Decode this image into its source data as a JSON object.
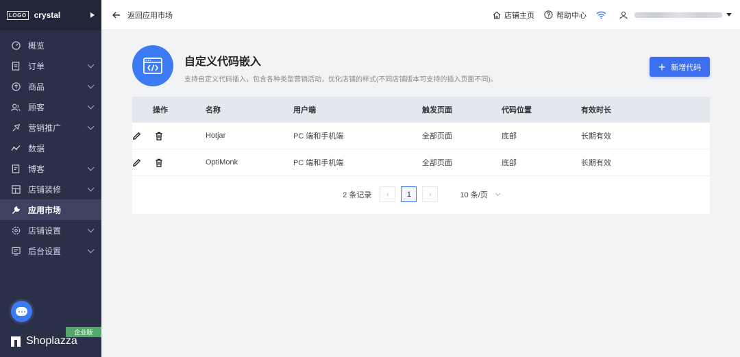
{
  "sidebar": {
    "logo": "LOGO",
    "store_name": "crystal",
    "items": [
      {
        "label": "概览",
        "icon": "dashboard-icon",
        "has_children": false
      },
      {
        "label": "订单",
        "icon": "order-icon",
        "has_children": true
      },
      {
        "label": "商品",
        "icon": "product-icon",
        "has_children": true
      },
      {
        "label": "顾客",
        "icon": "customers-icon",
        "has_children": true
      },
      {
        "label": "营销推广",
        "icon": "marketing-icon",
        "has_children": true
      },
      {
        "label": "数据",
        "icon": "analytics-icon",
        "has_children": false
      },
      {
        "label": "博客",
        "icon": "blog-icon",
        "has_children": true
      },
      {
        "label": "店铺装修",
        "icon": "theme-icon",
        "has_children": true
      },
      {
        "label": "应用市场",
        "icon": "wrench-icon",
        "has_children": false,
        "active": true
      },
      {
        "label": "店铺设置",
        "icon": "gear-icon",
        "has_children": true
      },
      {
        "label": "后台设置",
        "icon": "monitor-icon",
        "has_children": true
      }
    ],
    "edition_badge": "企业版",
    "footer_brand": "Shoplazza"
  },
  "topbar": {
    "back_label": "返回应用市场",
    "store_home": "店铺主页",
    "help_center": "帮助中心"
  },
  "page": {
    "title": "自定义代码嵌入",
    "description": "支持自定义代码插入，包含各种类型营销活动，优化店铺的样式(不同店铺版本可支持的插入页面不同)。",
    "new_button": "新增代码"
  },
  "table": {
    "headers": [
      "操作",
      "名称",
      "用户端",
      "触发页面",
      "代码位置",
      "有效时长"
    ],
    "rows": [
      {
        "name": "Hotjar",
        "client": "PC 端和手机端",
        "trigger": "全部页面",
        "position": "底部",
        "duration": "长期有效"
      },
      {
        "name": "OptiMonk",
        "client": "PC 端和手机端",
        "trigger": "全部页面",
        "position": "底部",
        "duration": "长期有效"
      }
    ]
  },
  "pagination": {
    "total": "2 条记录",
    "current_page": "1",
    "page_size": "10 条/页"
  },
  "colors": {
    "sidebar_bg": "#2b3049",
    "accent": "#3b6ff0",
    "table_header_bg": "#e4e7ee"
  }
}
